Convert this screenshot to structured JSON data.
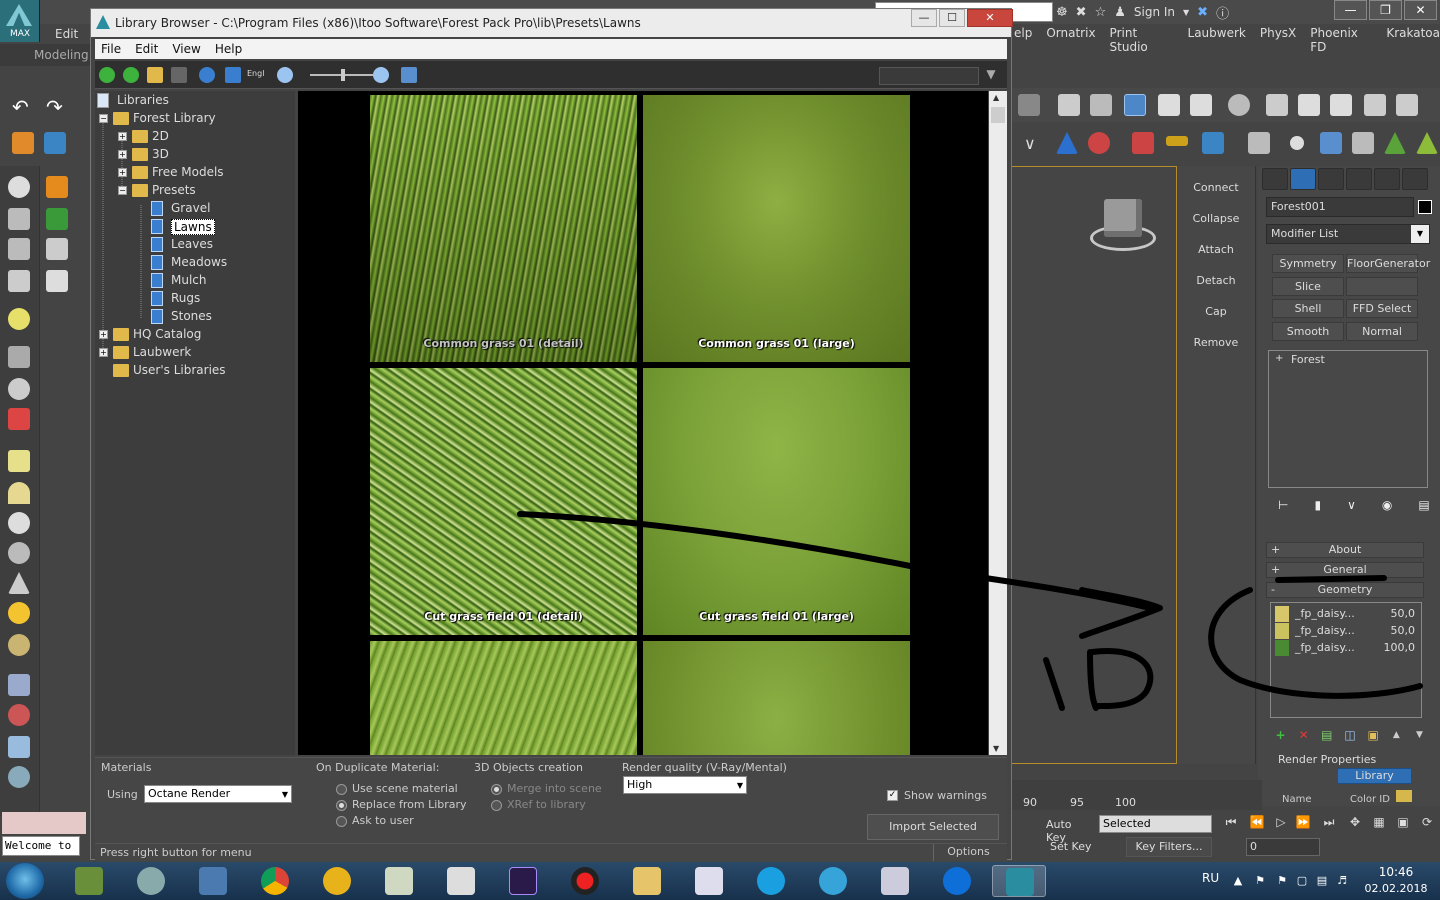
{
  "max": {
    "logo_label": "MAX",
    "edit_label": "Edit",
    "modeling_label": "Modeling",
    "sign_in_label": "Sign In",
    "menus": [
      "elp",
      "Ornatrix",
      "Print Studio",
      "Laubwerk",
      "PhysX",
      "Phoenix FD",
      "Krakatoa"
    ],
    "win_buttons": [
      "—",
      "❐",
      "✕"
    ],
    "command_buttons": [
      "Connect",
      "Collapse",
      "Attach",
      "Detach",
      "Cap",
      "Remove"
    ],
    "object_name": "Forest001",
    "modifier_list": "Modifier List",
    "modifier_buttons": [
      "Symmetry",
      "FloorGenerator",
      "Slice",
      "",
      "Shell",
      "FFD Select",
      "Smooth",
      "Normal"
    ],
    "stack_item": "Forest",
    "rollouts": {
      "about": "About",
      "general": "General",
      "geometry": "Geometry"
    },
    "geometry_items": [
      {
        "name": "_fp_daisy...",
        "value": "50,0",
        "color": "#d8c66a"
      },
      {
        "name": "_fp_daisy...",
        "value": "50,0",
        "color": "#c9c25e"
      },
      {
        "name": "_fp_daisy...",
        "value": "100,0",
        "color": "#4a8a33"
      }
    ],
    "render_properties_label": "Render Properties",
    "library_button": "Library",
    "name_label": "Name",
    "color_id_label": "Color ID",
    "timeline_ticks": [
      "90",
      "95",
      "100"
    ],
    "auto_key": "Auto Key",
    "set_key": "Set Key",
    "selected_value": "Selected",
    "key_filters": "Key Filters...",
    "frame_value": "0",
    "welcome_text": "Welcome to"
  },
  "library": {
    "title": "Library Browser - C:\\Program Files (x86)\\Itoo Software\\Forest Pack Pro\\lib\\Presets\\Lawns",
    "win_buttons": [
      "—",
      "☐",
      "✕"
    ],
    "menu": [
      "File",
      "Edit",
      "View",
      "Help"
    ],
    "lang_label": "Engl",
    "tree": {
      "root": "Libraries",
      "forest_library": "Forest Library",
      "children": [
        "2D",
        "3D",
        "Free Models",
        "Presets"
      ],
      "presets": [
        "Gravel",
        "Lawns",
        "Leaves",
        "Meadows",
        "Mulch",
        "Rugs",
        "Stones"
      ],
      "others": [
        "HQ Catalog",
        "Laubwerk",
        "User's Libraries"
      ],
      "expanders": {
        "collapse": "−",
        "expand": "+"
      }
    },
    "thumbnails": [
      "Common grass 01 (detail)",
      "Common grass 01 (large)",
      "Cut grass field 01 (detail)",
      "Cut grass field 01 (large)",
      "",
      ""
    ],
    "options": {
      "materials_label": "Materials",
      "using_label": "Using",
      "using_value": "Octane Render",
      "duplicate_label": "On Duplicate Material:",
      "duplicate_options": [
        "Use scene material",
        "Replace from Library",
        "Ask to user"
      ],
      "objects_label": "3D Objects creation",
      "objects_options": [
        "Merge into scene",
        "XRef to library"
      ],
      "quality_label": "Render quality (V-Ray/Mental)",
      "quality_value": "High",
      "show_warnings": "Show warnings",
      "import_button": "Import Selected"
    },
    "status_text": "Press right button for menu",
    "options_tab": "Options"
  },
  "annotation": {
    "text": "1D",
    "color": "#000000"
  },
  "taskbar": {
    "language": "RU",
    "time": "10:46",
    "date": "02.02.2018"
  }
}
